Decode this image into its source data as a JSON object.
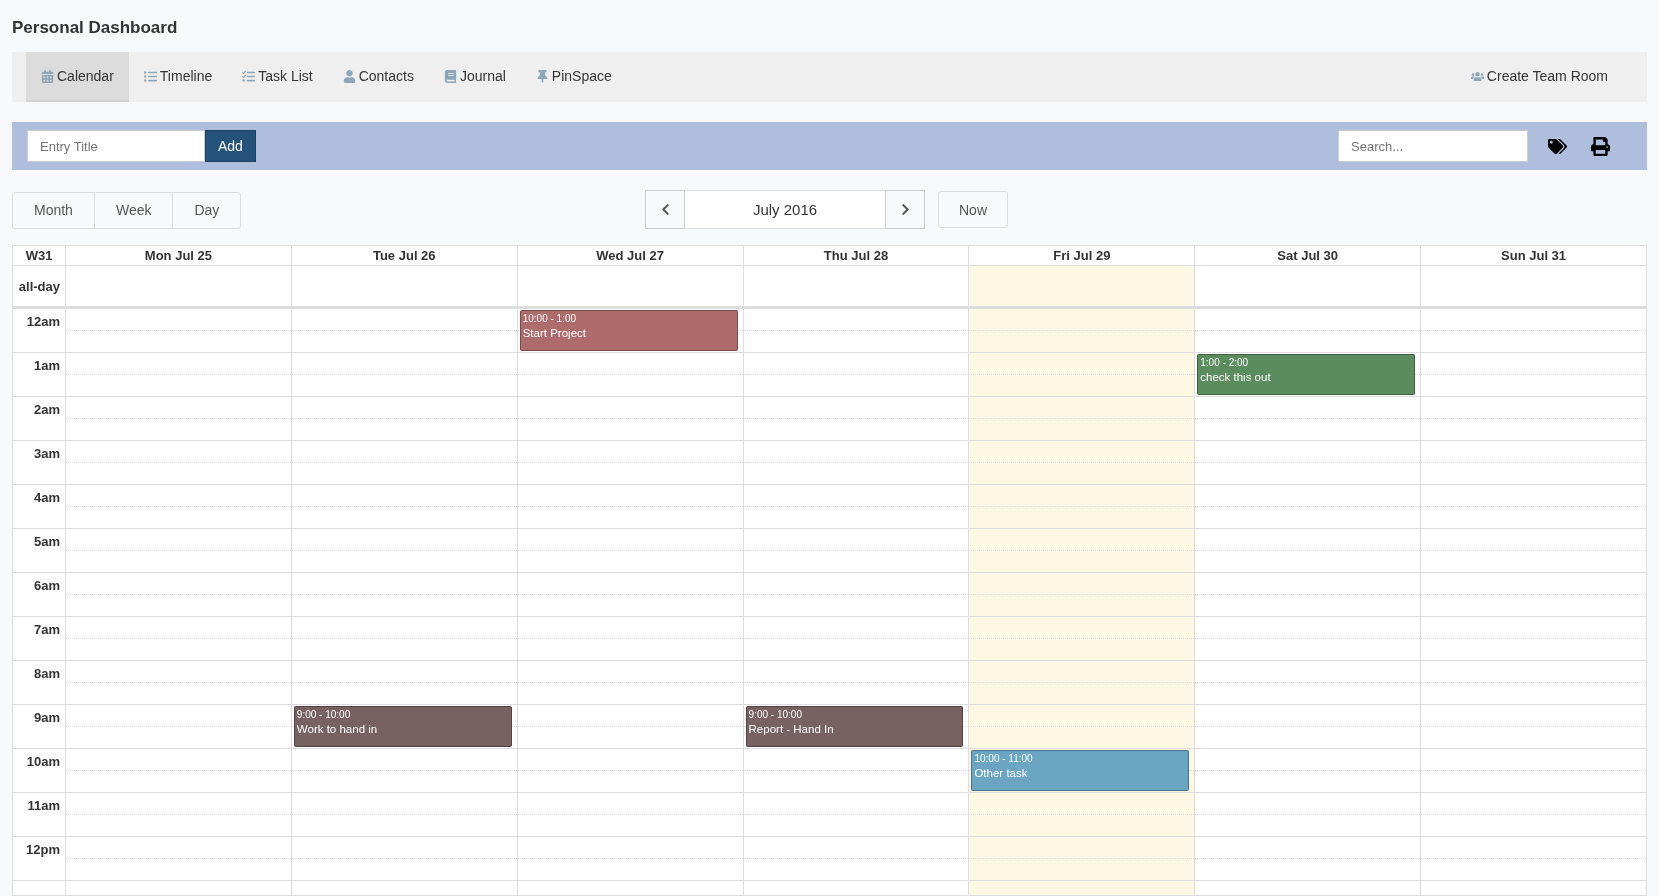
{
  "title": "Personal Dashboard",
  "nav": {
    "tabs": [
      {
        "label": "Calendar",
        "selected": true
      },
      {
        "label": "Timeline",
        "selected": false
      },
      {
        "label": "Task List",
        "selected": false
      },
      {
        "label": "Contacts",
        "selected": false
      },
      {
        "label": "Journal",
        "selected": false
      },
      {
        "label": "PinSpace",
        "selected": false
      }
    ],
    "right_action": {
      "label": "Create Team Room"
    }
  },
  "toolbar": {
    "entry": {
      "placeholder": "Entry Title"
    },
    "add_button": "Add",
    "search": {
      "placeholder": "Search..."
    }
  },
  "views": [
    {
      "label": "Month",
      "selected": false
    },
    {
      "label": "Week",
      "selected": false
    },
    {
      "label": "Day",
      "selected": false
    }
  ],
  "period": "July 2016",
  "now_button": "Now",
  "calendar": {
    "week": "W31",
    "allday_label": "all-day",
    "days": [
      {
        "label": "Mon Jul 25",
        "today": false
      },
      {
        "label": "Tue Jul 26",
        "today": false
      },
      {
        "label": "Wed Jul 27",
        "today": false
      },
      {
        "label": "Thu Jul 28",
        "today": false
      },
      {
        "label": "Fri Jul 29",
        "today": true
      },
      {
        "label": "Sat Jul 30",
        "today": false
      },
      {
        "label": "Sun Jul 31",
        "today": false
      }
    ],
    "hours": [
      {
        "label": "12am",
        "cells": [
          {},
          {},
          {
            "event": {
              "time": "10:00 - 1:00",
              "title": "Start Project",
              "color": "#ad6b6b"
            }
          },
          {},
          {},
          {},
          {}
        ]
      },
      {
        "label": "1am",
        "cells": [
          {},
          {},
          {},
          {},
          {},
          {
            "event": {
              "time": "1:00 - 2:00",
              "title": "check this out",
              "color": "#5b8c5d"
            }
          },
          {}
        ]
      },
      {
        "label": "2am"
      },
      {
        "label": "3am"
      },
      {
        "label": "4am"
      },
      {
        "label": "5am"
      },
      {
        "label": "6am"
      },
      {
        "label": "7am"
      },
      {
        "label": "8am"
      },
      {
        "label": "9am",
        "cells": [
          {},
          {
            "event": {
              "time": "9:00 - 10:00",
              "title": "Work to hand in",
              "color": "#776163"
            }
          },
          {},
          {
            "event": {
              "time": "9:00 - 10:00",
              "title": "Report - Hand In",
              "color": "#776163"
            }
          },
          {},
          {},
          {}
        ]
      },
      {
        "label": "10am",
        "cells": [
          {},
          {},
          {},
          {},
          {
            "event": {
              "time": "10:00 - 11:00",
              "title": "Other task",
              "color": "#6aa5c4"
            }
          },
          {},
          {}
        ]
      },
      {
        "label": "11am"
      },
      {
        "label": "12pm"
      }
    ]
  }
}
